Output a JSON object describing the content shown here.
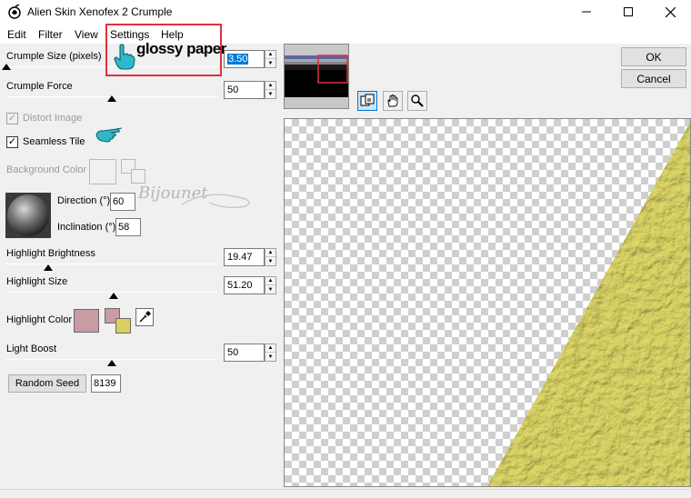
{
  "window": {
    "title": "Alien Skin Xenofex 2 Crumple",
    "minimize_icon": "minimize-icon",
    "maximize_icon": "maximize-icon",
    "close_icon": "close-icon"
  },
  "menu": {
    "items": [
      {
        "label": "Edit"
      },
      {
        "label": "Filter"
      },
      {
        "label": "View"
      },
      {
        "label": "Settings"
      },
      {
        "label": "Help"
      }
    ]
  },
  "annotation": {
    "text": "glossy paper",
    "box_color": "#e0303a"
  },
  "controls": {
    "crumple_size": {
      "label": "Crumple Size (pixels)",
      "value": "3.50"
    },
    "crumple_force": {
      "label": "Crumple Force",
      "value": "50"
    },
    "distort_image": {
      "label": "Distort Image",
      "checked": true,
      "enabled": false
    },
    "seamless_tile": {
      "label": "Seamless Tile",
      "checked": true,
      "enabled": true
    },
    "background_color": {
      "label": "Background Color",
      "enabled": false
    },
    "direction": {
      "label": "Direction (°)",
      "value": "60"
    },
    "inclination": {
      "label": "Inclination (°)",
      "value": "58"
    },
    "highlight_brightness": {
      "label": "Highlight Brightness",
      "value": "19.47"
    },
    "highlight_size": {
      "label": "Highlight Size",
      "value": "51.20"
    },
    "highlight_color": {
      "label": "Highlight Color",
      "color": "#c99ba3",
      "secondary_color": "#d8d060"
    },
    "light_boost": {
      "label": "Light Boost",
      "value": "50"
    },
    "random_seed": {
      "button_label": "Random Seed",
      "value": "8139"
    }
  },
  "slider_levels": {
    "crumple_size": 0.0,
    "crumple_force": 0.5,
    "highlight_brightness": 0.2,
    "highlight_size": 0.51,
    "light_boost": 0.5
  },
  "buttons": {
    "ok": "OK",
    "cancel": "Cancel"
  },
  "preview": {
    "texture_color": "#d8d060",
    "tools": [
      "preview-toggle-icon",
      "hand-icon",
      "zoom-icon"
    ]
  },
  "watermark": {
    "text": "Bijounet"
  }
}
